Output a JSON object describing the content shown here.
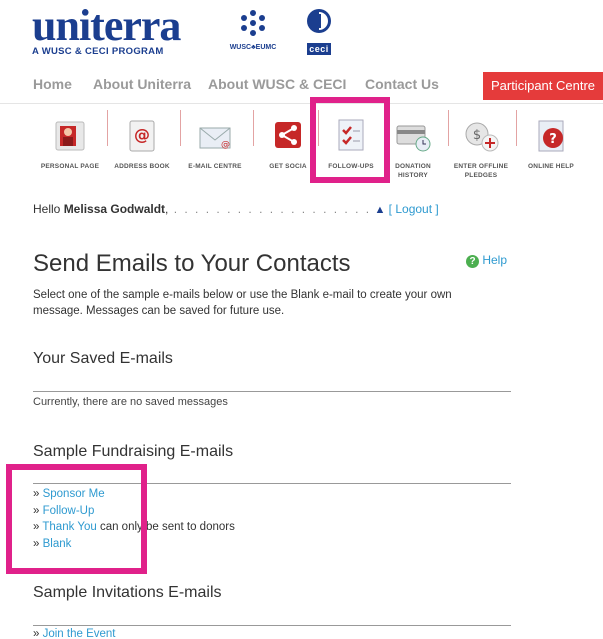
{
  "header": {
    "logo_word": "uniterra",
    "logo_tagline": "A WUSC & CECI PROGRAM",
    "wusc_label": "WUSC♣EUMC",
    "ceci_label": "ceci"
  },
  "nav": {
    "items": [
      "Home",
      "About Uniterra",
      "About WUSC & CECI",
      "Contact Us"
    ],
    "participant_centre": "Participant Centre"
  },
  "tools": [
    {
      "label": "PERSONAL PAGE",
      "icon": "personal-page-icon"
    },
    {
      "label": "ADDRESS BOOK",
      "icon": "address-book-icon"
    },
    {
      "label": "E-MAIL CENTRE",
      "icon": "email-centre-icon"
    },
    {
      "label": "GET SOCIA",
      "icon": "share-icon"
    },
    {
      "label": "FOLLOW-UPS",
      "icon": "checklist-icon"
    },
    {
      "label": "DONATION HISTORY",
      "icon": "donation-history-icon"
    },
    {
      "label": "ENTER OFFLINE PLEDGES",
      "icon": "offline-pledges-icon"
    },
    {
      "label": "ONLINE HELP",
      "icon": "help-icon"
    }
  ],
  "greeting": {
    "prefix": "Hello ",
    "name": "Melissa Godwaldt",
    "suffix": ",",
    "dots": " . . . . . . . . . . . . . . . . . . .",
    "logout": "[ Logout ]"
  },
  "page": {
    "title": "Send Emails to Your Contacts",
    "help_label": "Help",
    "intro": "Select one of the sample e-mails below or use the Blank e-mail to create your own message. Messages can be saved for future use."
  },
  "saved": {
    "heading": "Your Saved E-mails",
    "empty": "Currently, there are no saved messages"
  },
  "fundraising": {
    "heading": "Sample Fundraising E-mails",
    "bullet": "» ",
    "items": [
      "Sponsor Me",
      "Follow-Up",
      "Thank You",
      "Blank"
    ],
    "thank_you_note": " can only be sent to donors"
  },
  "invitations": {
    "heading": "Sample Invitations E-mails",
    "items": [
      "Join the Event"
    ]
  },
  "colors": {
    "brand_blue": "#1b3e8f",
    "link": "#2e9ad0",
    "participant_red": "#e53b3b",
    "highlight_magenta": "#e0218a"
  }
}
